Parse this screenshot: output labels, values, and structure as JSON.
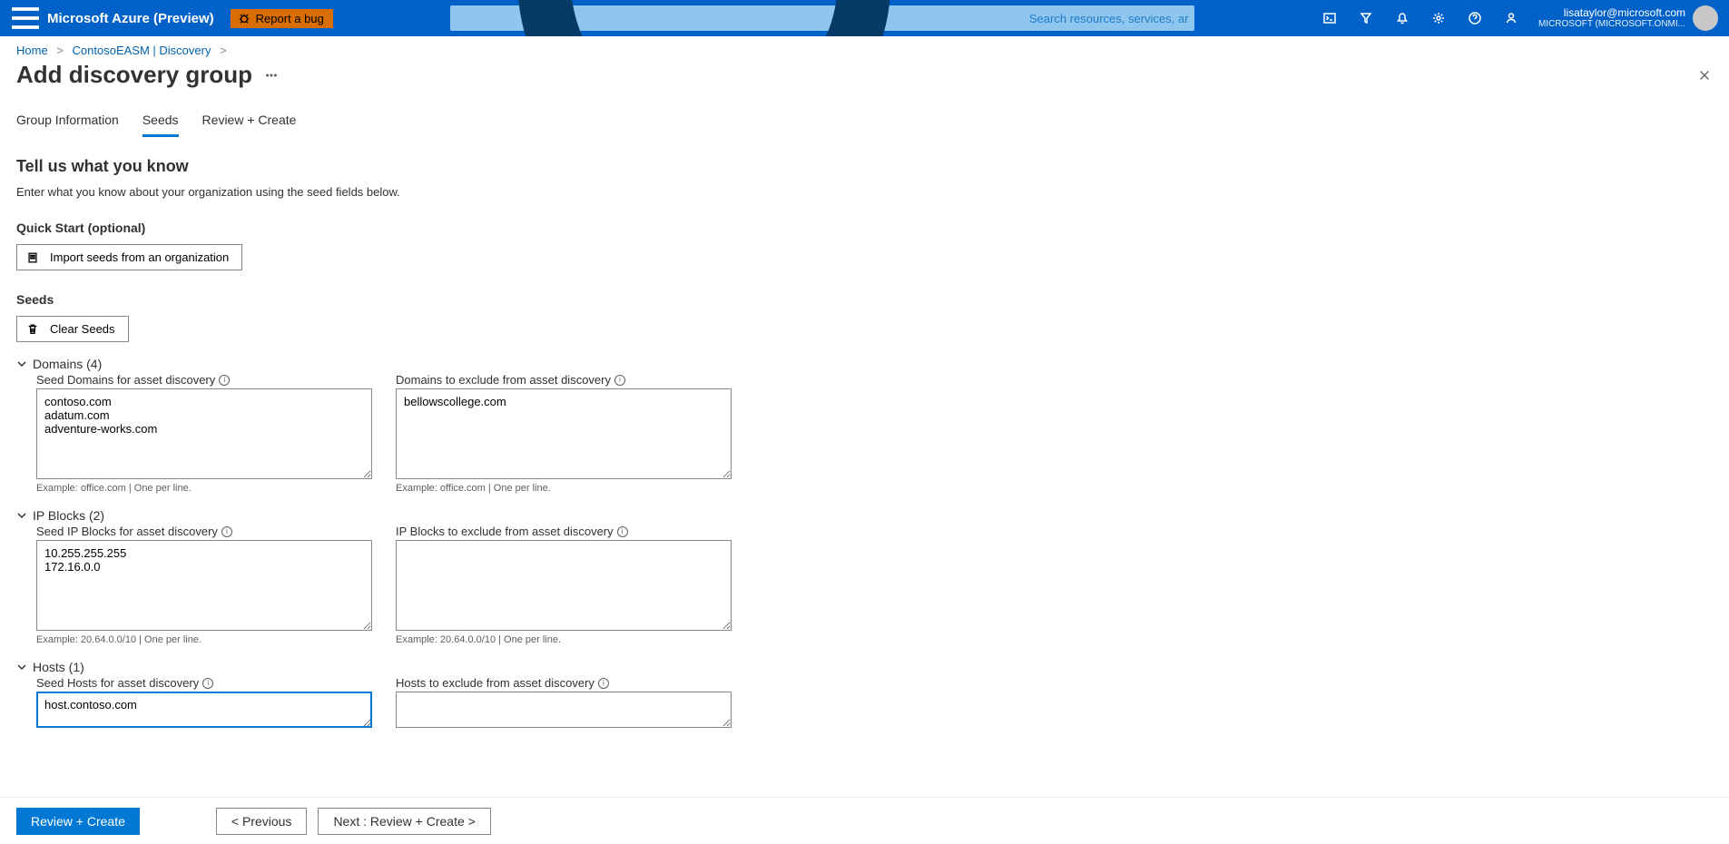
{
  "header": {
    "brand": "Microsoft Azure (Preview)",
    "bug_label": "Report a bug",
    "search_placeholder": "Search resources, services, and docs (G+/)",
    "account_email": "lisataylor@microsoft.com",
    "account_dir": "MICROSOFT (MICROSOFT.ONMI..."
  },
  "breadcrumb": {
    "items": [
      "Home",
      "ContosoEASM | Discovery"
    ]
  },
  "page": {
    "title": "Add discovery group",
    "tabs": [
      "Group Information",
      "Seeds",
      "Review + Create"
    ],
    "active_tab": "Seeds",
    "section_title": "Tell us what you know",
    "section_sub": "Enter what you know about your organization using the seed fields below.",
    "quick_start_label": "Quick Start (optional)",
    "import_btn": "Import seeds from an organization",
    "seeds_label": "Seeds",
    "clear_btn": "Clear Seeds"
  },
  "groups": {
    "domains": {
      "title": "Domains (4)",
      "seed_label": "Seed Domains for asset discovery",
      "seed_value": "contoso.com\nadatum.com\nadventure-works.com",
      "excl_label": "Domains to exclude from asset discovery",
      "excl_value": "bellowscollege.com",
      "hint": "Example: office.com | One per line."
    },
    "ipblocks": {
      "title": "IP Blocks (2)",
      "seed_label": "Seed IP Blocks for asset discovery",
      "seed_value": "10.255.255.255\n172.16.0.0",
      "excl_label": "IP Blocks to exclude from asset discovery",
      "excl_value": "",
      "hint": "Example: 20.64.0.0/10 | One per line."
    },
    "hosts": {
      "title": "Hosts (1)",
      "seed_label": "Seed Hosts for asset discovery",
      "seed_value": "host.contoso.com\n",
      "excl_label": "Hosts to exclude from asset discovery",
      "excl_value": ""
    }
  },
  "footer": {
    "primary": "Review + Create",
    "prev": "<  Previous",
    "next": "Next : Review + Create  >"
  }
}
